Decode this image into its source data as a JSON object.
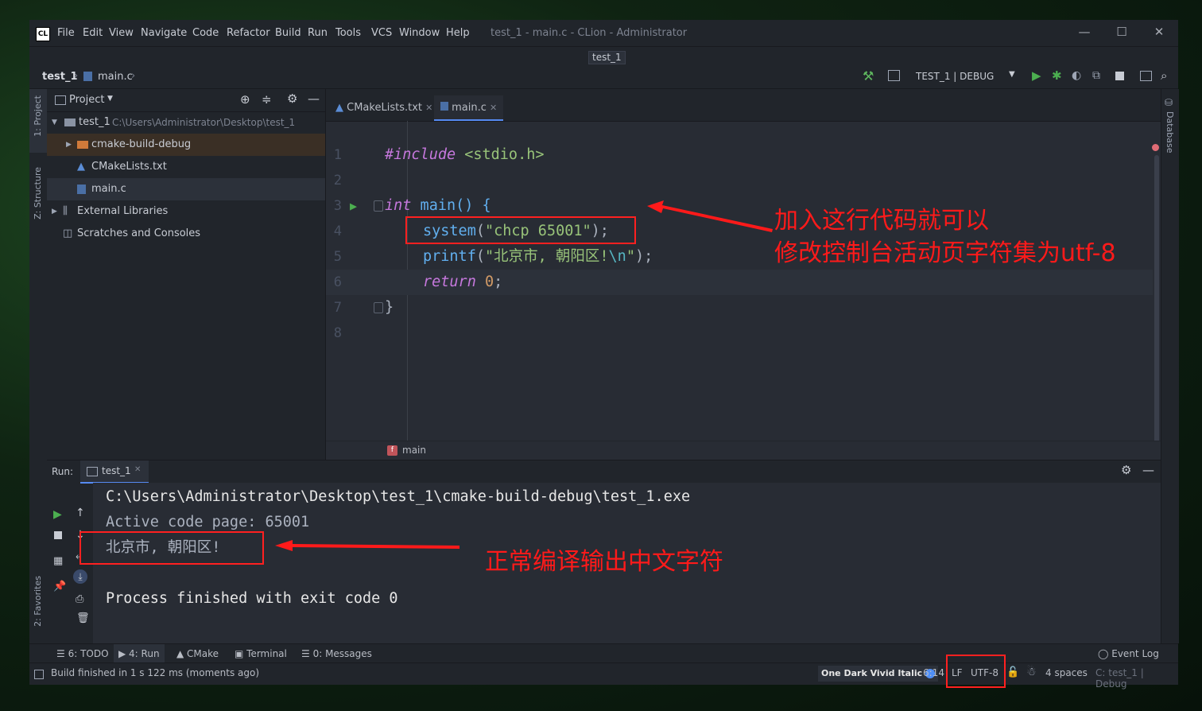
{
  "window": {
    "title": "test_1 - main.c - CLion - Administrator",
    "project_tag": "test_1",
    "menu": [
      "File",
      "Edit",
      "View",
      "Navigate",
      "Code",
      "Refactor",
      "Build",
      "Run",
      "Tools",
      "VCS",
      "Window",
      "Help"
    ]
  },
  "breadcrumb": {
    "project": "test_1",
    "file": "main.c"
  },
  "run_config": "TEST_1 | DEBUG",
  "left_strip": {
    "project": "1: Project",
    "structure": "Z: Structure",
    "favorites": "2: Favorites"
  },
  "right_strip": {
    "database": "Database"
  },
  "project_panel": {
    "title": "Project",
    "root": {
      "name": "test_1",
      "path": "C:\\Users\\Administrator\\Desktop\\test_1"
    },
    "items": [
      "cmake-build-debug",
      "CMakeLists.txt",
      "main.c",
      "External Libraries",
      "Scratches and Consoles"
    ]
  },
  "editor": {
    "tabs": [
      "CMakeLists.txt",
      "main.c"
    ],
    "line_numbers": [
      "1",
      "2",
      "3",
      "4",
      "5",
      "6",
      "7",
      "8"
    ],
    "code": {
      "l1_directive": "#include",
      "l1_header": " <stdio.h>",
      "l3_type": "int",
      "l3_rest": " main() {",
      "l4_fn": "system",
      "l4_open": "(",
      "l4_str": "\"chcp 65001\"",
      "l4_close": ");",
      "l5_fn": "printf",
      "l5_open": "(",
      "l5_str": "\"北京市, 朝阳区!",
      "l5_esc": "\\n",
      "l5_strend": "\"",
      "l5_close": ");",
      "l6_kw": "return",
      "l6_num": "0",
      "l6_end": ";",
      "l7": "}"
    },
    "breadcrumb_fn": "main"
  },
  "annotations": {
    "top_line1": "加入这行代码就可以",
    "top_line2": "修改控制台活动页字符集为utf-8",
    "bottom": "正常编译输出中文字符"
  },
  "run_panel": {
    "label": "Run:",
    "tab": "test_1",
    "output": [
      "C:\\Users\\Administrator\\Desktop\\test_1\\cmake-build-debug\\test_1.exe",
      "Active code page: 65001",
      "北京市, 朝阳区!",
      "",
      "Process finished with exit code 0"
    ]
  },
  "tool_windows": [
    "6: TODO",
    "4: Run",
    "CMake",
    "Terminal",
    "0: Messages"
  ],
  "event_log": "Event Log",
  "status": {
    "message": "Build finished in 1 s 122 ms (moments ago)",
    "theme": "One Dark Vivid Italic",
    "position": "6:14",
    "line_sep": "LF",
    "encoding": "UTF-8",
    "indent": "4 spaces",
    "context": "C: test_1 | Debug"
  },
  "colors": {
    "accent_red": "#ff1a1a",
    "run_green": "#4caf50",
    "editor_bg": "#282c34"
  }
}
